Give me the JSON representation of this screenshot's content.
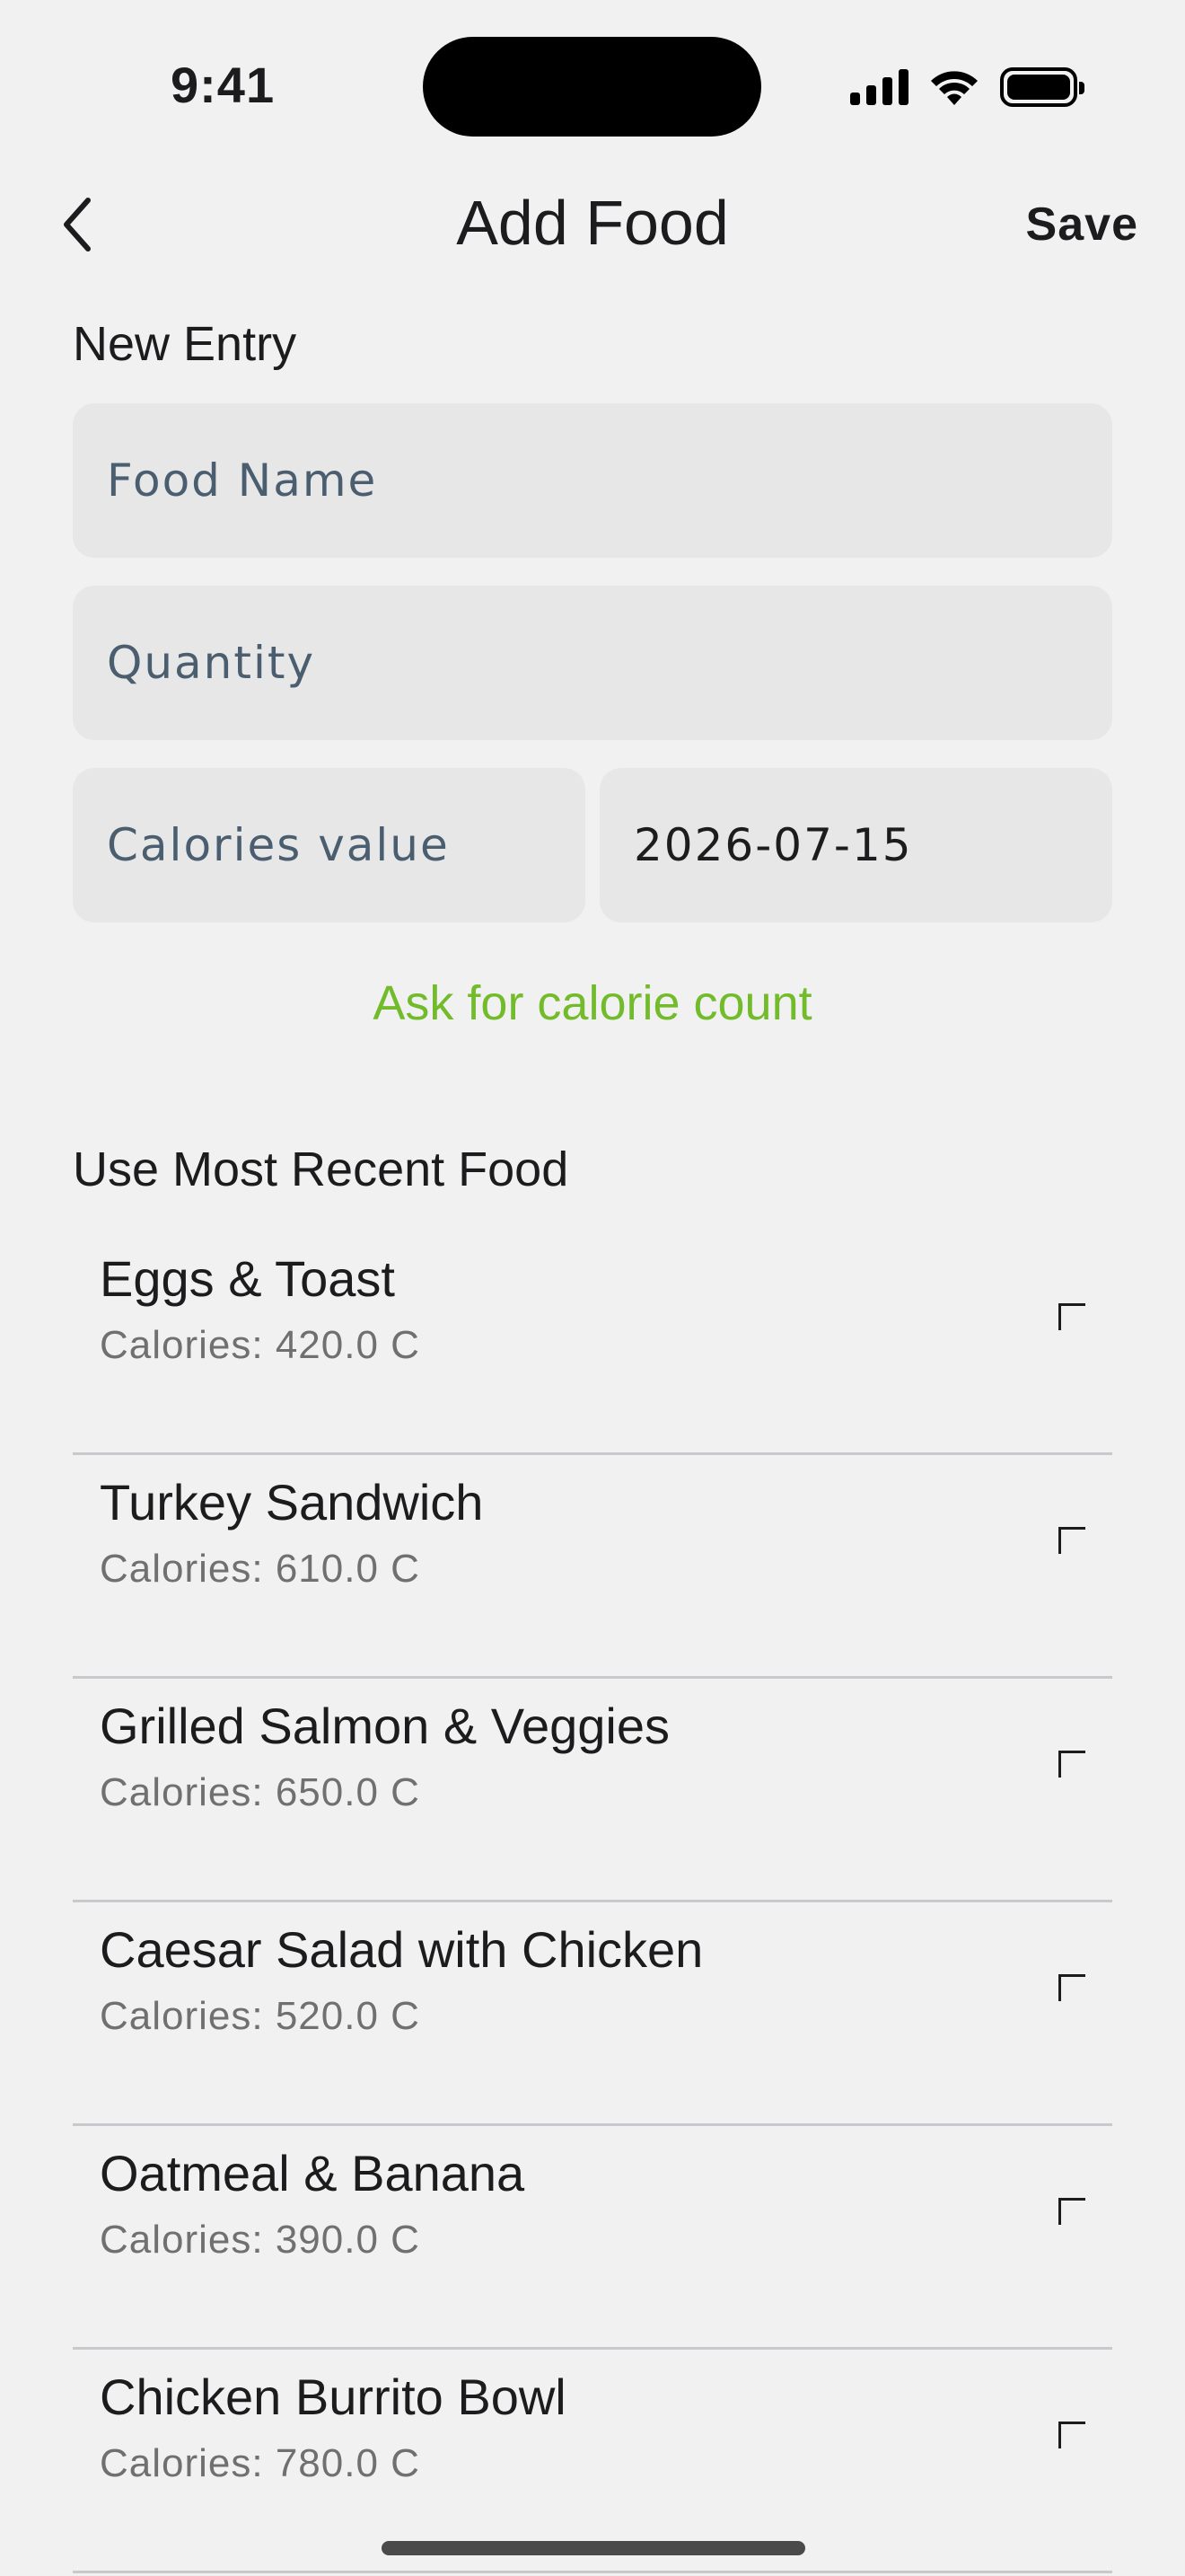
{
  "status_bar": {
    "time": "9:41"
  },
  "nav": {
    "title": "Add Food",
    "save_label": "Save"
  },
  "new_entry": {
    "heading": "New Entry",
    "food_name": {
      "placeholder": "Food Name",
      "value": ""
    },
    "quantity": {
      "placeholder": "Quantity",
      "value": ""
    },
    "calories": {
      "placeholder": "Calories value",
      "value": ""
    },
    "date": {
      "value": "2026-07-15"
    },
    "ask_link": "Ask for calorie count"
  },
  "recent": {
    "heading": "Use Most Recent Food",
    "items": [
      {
        "name": "Eggs & Toast",
        "calories": "Calories: 420.0 C"
      },
      {
        "name": "Turkey Sandwich",
        "calories": "Calories: 610.0 C"
      },
      {
        "name": "Grilled Salmon & Veggies",
        "calories": "Calories: 650.0 C"
      },
      {
        "name": "Caesar Salad with Chicken",
        "calories": "Calories: 520.0 C"
      },
      {
        "name": "Oatmeal & Banana",
        "calories": "Calories: 390.0 C"
      },
      {
        "name": "Chicken Burrito Bowl",
        "calories": "Calories: 780.0 C"
      }
    ]
  },
  "icons": {
    "back": "chevron-left-icon",
    "add": "plus-icon",
    "signal": "cellular-signal-icon",
    "wifi": "wifi-icon",
    "battery": "battery-icon"
  },
  "colors": {
    "background": "#f1f1f1",
    "field_bg": "#e7e7e7",
    "accent_green": "#72bb2b",
    "placeholder": "#4b5e70",
    "secondary_text": "#707070"
  }
}
